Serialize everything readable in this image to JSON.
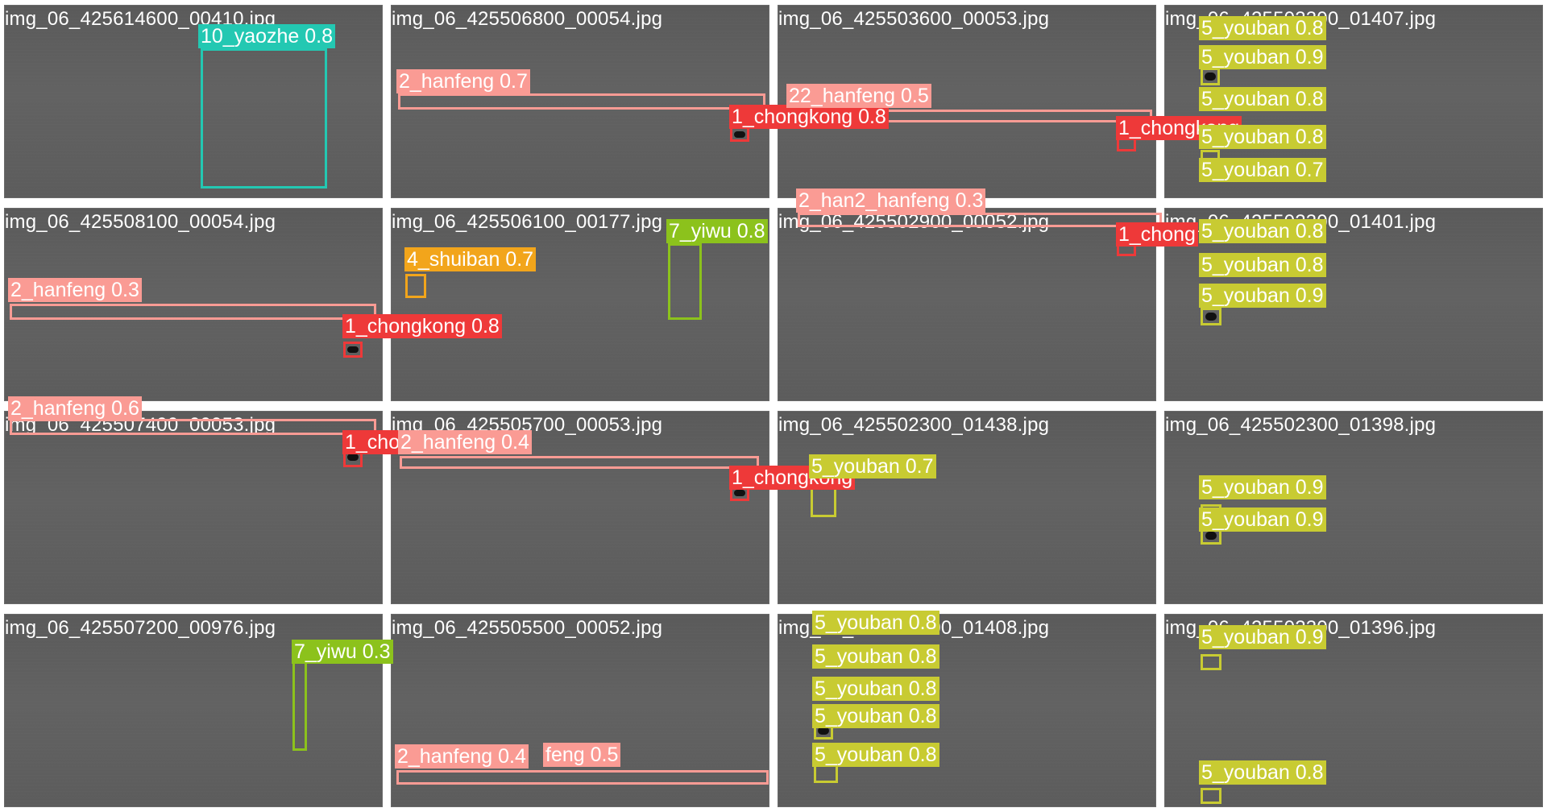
{
  "colors": {
    "hanfeng": "#fa9b94",
    "chongkong": "#ee3939",
    "youban": "#c8cb32",
    "yiwu": "#8cc21c",
    "shuiban": "#f2a51b",
    "yaozhe": "#23c8b2"
  },
  "tiles": [
    {
      "filename": "img_06_425614600_00410.jpg",
      "detections": [
        {
          "label": "10_yaozhe 0.8",
          "class": "yaozhe"
        }
      ]
    },
    {
      "filename": "img_06_425506800_00054.jpg",
      "detections": [
        {
          "label": "2_hanfeng 0.7",
          "class": "hanfeng"
        },
        {
          "label": "1_chongkong 0.8",
          "class": "chongkong"
        }
      ]
    },
    {
      "filename": "img_06_425503600_00053.jpg",
      "detections": [
        {
          "label": "22_hanfeng 0.5",
          "class": "hanfeng"
        },
        {
          "label": "1_chongkong",
          "class": "chongkong"
        }
      ]
    },
    {
      "filename": "img_06_425503300_01407.jpg",
      "detections": [
        {
          "label": "5_youban 0.8",
          "class": "youban"
        },
        {
          "label": "5_youban 0.9",
          "class": "youban"
        },
        {
          "label": "5_youban 0.8",
          "class": "youban"
        },
        {
          "label": "5_youban 0.8",
          "class": "youban"
        },
        {
          "label": "5_youban 0.7",
          "class": "youban"
        }
      ]
    },
    {
      "filename": "img_06_425508100_00054.jpg",
      "detections": [
        {
          "label": "2_hanfeng 0.3",
          "class": "hanfeng"
        },
        {
          "label": "1_chongkong 0.8",
          "class": "chongkong"
        }
      ]
    },
    {
      "filename": "img_06_425506100_00177.jpg",
      "detections": [
        {
          "label": "4_shuiban 0.7",
          "class": "shuiban"
        },
        {
          "label": "7_yiwu 0.8",
          "class": "yiwu"
        }
      ]
    },
    {
      "filename": "img_06_425502900_00052.jpg",
      "detections": [
        {
          "label": "2_han2_hanfeng 0.3",
          "class": "hanfeng"
        },
        {
          "label": "1_chong",
          "class": "chongkong"
        }
      ]
    },
    {
      "filename": "img_06_425502300_01401.jpg",
      "detections": [
        {
          "label": "5_youban 0.8",
          "class": "youban"
        },
        {
          "label": "5_youban 0.8",
          "class": "youban"
        },
        {
          "label": "5_youban 0.9",
          "class": "youban"
        }
      ]
    },
    {
      "filename": "img_06_425507400_00053.jpg",
      "detections": [
        {
          "label": "2_hanfeng 0.6",
          "class": "hanfeng"
        },
        {
          "label": "1_cho",
          "class": "chongkong"
        }
      ]
    },
    {
      "filename": "img_06_425505700_00053.jpg",
      "detections": [
        {
          "label": "2_hanfeng 0.4",
          "class": "hanfeng"
        },
        {
          "label": "1_chongkong",
          "class": "chongkong"
        }
      ]
    },
    {
      "filename": "img_06_425502300_01438.jpg",
      "detections": [
        {
          "label": "5_youban 0.7",
          "class": "youban"
        }
      ]
    },
    {
      "filename": "img_06_425502300_01398.jpg",
      "detections": [
        {
          "label": "5_youban 0.9",
          "class": "youban"
        },
        {
          "label": "5_youban 0.9",
          "class": "youban"
        }
      ]
    },
    {
      "filename": "img_06_425507200_00976.jpg",
      "detections": [
        {
          "label": "7_yiwu 0.3",
          "class": "yiwu"
        }
      ]
    },
    {
      "filename": "img_06_425505500_00052.jpg",
      "detections": [
        {
          "label": "2_hanfeng 0.4",
          "class": "hanfeng"
        },
        {
          "label": "feng 0.5",
          "class": "hanfeng"
        }
      ]
    },
    {
      "filename": "img_06_425502300_01408.jpg",
      "detections": [
        {
          "label": "5_youban 0.8",
          "class": "youban"
        },
        {
          "label": "5_youban 0.8",
          "class": "youban"
        },
        {
          "label": "5_youban 0.8",
          "class": "youban"
        },
        {
          "label": "5_youban 0.8",
          "class": "youban"
        },
        {
          "label": "5_youban 0.8",
          "class": "youban"
        }
      ]
    },
    {
      "filename": "img_06_425502300_01396.jpg",
      "detections": [
        {
          "label": "5_youban 0.9",
          "class": "youban"
        },
        {
          "label": "5_youban 0.8",
          "class": "youban"
        }
      ]
    }
  ]
}
